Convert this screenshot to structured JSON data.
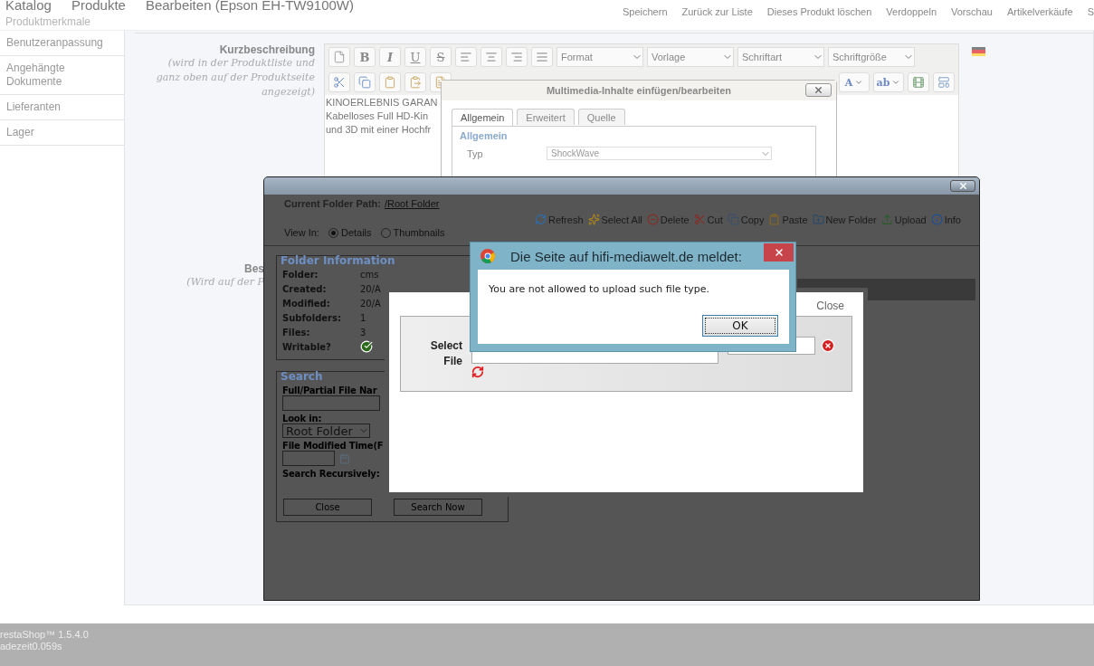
{
  "header": {
    "breadcrumb": [
      "Katalog",
      "Produkte",
      "Bearbeiten (Epson EH-TW9100W)"
    ],
    "actions": [
      "Speichern",
      "Zurück zur Liste",
      "Dieses Produkt löschen",
      "Verdoppeln",
      "Vorschau",
      "Artikelverkäufe",
      "S"
    ]
  },
  "sidebar": {
    "faded_item": "Produktmerkmale",
    "items": [
      "Benutzeranpassung",
      "Angehängte Dokumente",
      "Lieferanten",
      "Lager"
    ]
  },
  "form": {
    "short_description": {
      "label": "Kurzbeschreibung",
      "hint": "(wird in der Produktliste und ganz oben auf der Produktseite angezeigt)",
      "lines": [
        "KINOERLEBNIS GARAN",
        "Kabelloses Full HD-Kin",
        "und 3D mit einer Hochfr"
      ]
    },
    "description": {
      "label": "Bes",
      "hint": "(Wird auf der P"
    }
  },
  "editor": {
    "row1": [
      {
        "kind": "new-doc"
      },
      {
        "kind": "bold",
        "label": "B"
      },
      {
        "kind": "italic",
        "label": "I"
      },
      {
        "kind": "underline",
        "label": "U"
      },
      {
        "kind": "strike",
        "label": "S"
      },
      {
        "kind": "align-left"
      },
      {
        "kind": "align-center"
      },
      {
        "kind": "align-right"
      },
      {
        "kind": "justify"
      }
    ],
    "dropdowns": [
      "Format",
      "Vorlage",
      "Schriftart",
      "Schriftgröße"
    ],
    "row2_left": [
      {
        "kind": "cut"
      },
      {
        "kind": "copy"
      },
      {
        "kind": "paste"
      },
      {
        "kind": "paste-text"
      },
      {
        "kind": "paste-word"
      }
    ],
    "row2_right": [
      {
        "kind": "text-color",
        "label": "A"
      },
      {
        "kind": "highlight",
        "label": "ab"
      },
      {
        "kind": "film"
      },
      {
        "kind": "template"
      }
    ]
  },
  "media_dialog": {
    "title": "Multimedia-Inhalte einfügen/bearbeiten",
    "tabs": [
      {
        "label": "Allgemein",
        "selected": true
      },
      {
        "label": "Erweitert",
        "selected": false
      },
      {
        "label": "Quelle",
        "selected": false
      }
    ],
    "legend": "Allgemein",
    "type_label": "Typ",
    "type_value": "ShockWave"
  },
  "file_manager": {
    "path_label": "Current Folder Path:",
    "path_link": "/Root Folder",
    "tools": [
      {
        "kind": "refresh",
        "label": "Refresh"
      },
      {
        "kind": "select-all",
        "label": "Select All"
      },
      {
        "kind": "delete",
        "label": "Delete"
      },
      {
        "kind": "cut",
        "label": "Cut"
      },
      {
        "kind": "copy",
        "label": "Copy"
      },
      {
        "kind": "paste",
        "label": "Paste"
      },
      {
        "kind": "new-folder",
        "label": "New Folder"
      },
      {
        "kind": "upload",
        "label": "Upload"
      },
      {
        "kind": "info",
        "label": "Info"
      }
    ],
    "view": {
      "label": "View In:",
      "options": [
        {
          "label": "Details",
          "selected": true
        },
        {
          "label": "Thumbnails",
          "selected": false
        }
      ]
    },
    "folder_info": {
      "legend": "Folder Information",
      "rows": [
        {
          "label": "Folder:",
          "value": "cms"
        },
        {
          "label": "Created:",
          "value": "20/A"
        },
        {
          "label": "Modified:",
          "value": "20/A"
        },
        {
          "label": "Subfolders:",
          "value": "1"
        },
        {
          "label": "Files:",
          "value": "3"
        },
        {
          "label": "Writable?",
          "writable": true
        }
      ]
    },
    "search": {
      "legend": "Search",
      "name_label": "Full/Partial File Nar",
      "look_in_label": "Look in:",
      "look_in_value": "Root Folder",
      "time_label": "File Modified Time(F",
      "recursive_label": "Search Recursively:",
      "buttons": [
        "Close",
        "Search Now"
      ]
    }
  },
  "upload_panel": {
    "close": "Close",
    "select_label": "Select File"
  },
  "alert": {
    "title": "Die Seite auf hifi-mediawelt.de meldet:",
    "message": "You are not allowed to upload such file type.",
    "button": "OK"
  },
  "footer": {
    "lines": [
      "restaShop™ 1.5.4.0",
      "adezeit0.059s"
    ]
  }
}
